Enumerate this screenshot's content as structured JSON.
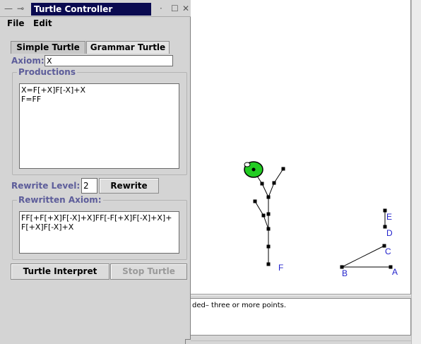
{
  "window": {
    "title": "Turtle Controller",
    "minimize_glyph": "—",
    "pin_glyph": "⊸",
    "dot_glyph": "·",
    "maximize_glyph": "☐",
    "close_glyph": "✕"
  },
  "menu": {
    "file": "File",
    "edit": "Edit"
  },
  "tabs": {
    "simple": "Simple Turtle",
    "grammar": "Grammar Turtle"
  },
  "axiom": {
    "label": "Axiom:",
    "value": "X"
  },
  "productions": {
    "label": "Productions",
    "value": "X=F[+X]F[-X]+X\nF=FF"
  },
  "rewrite": {
    "level_label": "Rewrite Level:",
    "level_value": "2",
    "button": "Rewrite"
  },
  "rewritten": {
    "label": "Rewritten Axiom:",
    "value": "FF[+F[+X]F[-X]+X]FF[-F[+X]F[-X]+X]+\nF[+X]F[-X]+X"
  },
  "actions": {
    "interpret": "Turtle Interpret",
    "stop": "Stop Turtle"
  },
  "canvas": {
    "point_labels": {
      "A": "A",
      "B": "B",
      "C": "C",
      "D": "D",
      "E": "E",
      "F": "F"
    },
    "message": "ded– three or more points.",
    "turtle_color": "#22cc22",
    "label_color": "#2222cc"
  }
}
